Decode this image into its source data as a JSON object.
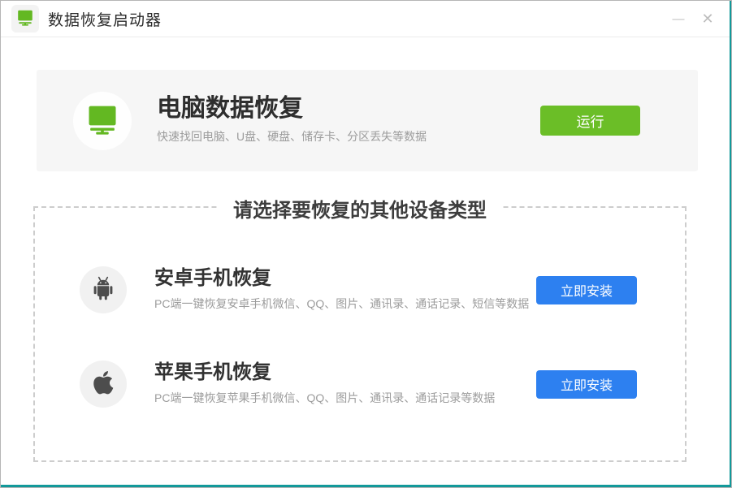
{
  "window": {
    "title": "数据恢复启动器",
    "minimize_icon": "—",
    "close_icon": "✕"
  },
  "colors": {
    "run_button_green": "#6bbe27",
    "install_button_blue": "#2d80f0",
    "icon_green": "#63b822",
    "accent_teal_border": "#12999a",
    "card_background": "#f6f6f6"
  },
  "icons": {
    "app": "green-monitor-icon",
    "pc": "green-monitor-icon",
    "android": "android-robot-icon",
    "ios": "apple-logo-icon"
  },
  "pc_card": {
    "title": "电脑数据恢复",
    "subtitle": "快速找回电脑、U盘、硬盘、储存卡、分区丢失等数据",
    "button": "运行"
  },
  "other_section": {
    "title": "请选择要恢复的其他设备类型",
    "devices": [
      {
        "id": "android",
        "title": "安卓手机恢复",
        "subtitle": "PC端一键恢复安卓手机微信、QQ、图片、通讯录、通话记录、短信等数据",
        "button": "立即安装"
      },
      {
        "id": "ios",
        "title": "苹果手机恢复",
        "subtitle": "PC端一键恢复苹果手机微信、QQ、图片、通讯录、通话记录等数据",
        "button": "立即安装"
      }
    ]
  }
}
